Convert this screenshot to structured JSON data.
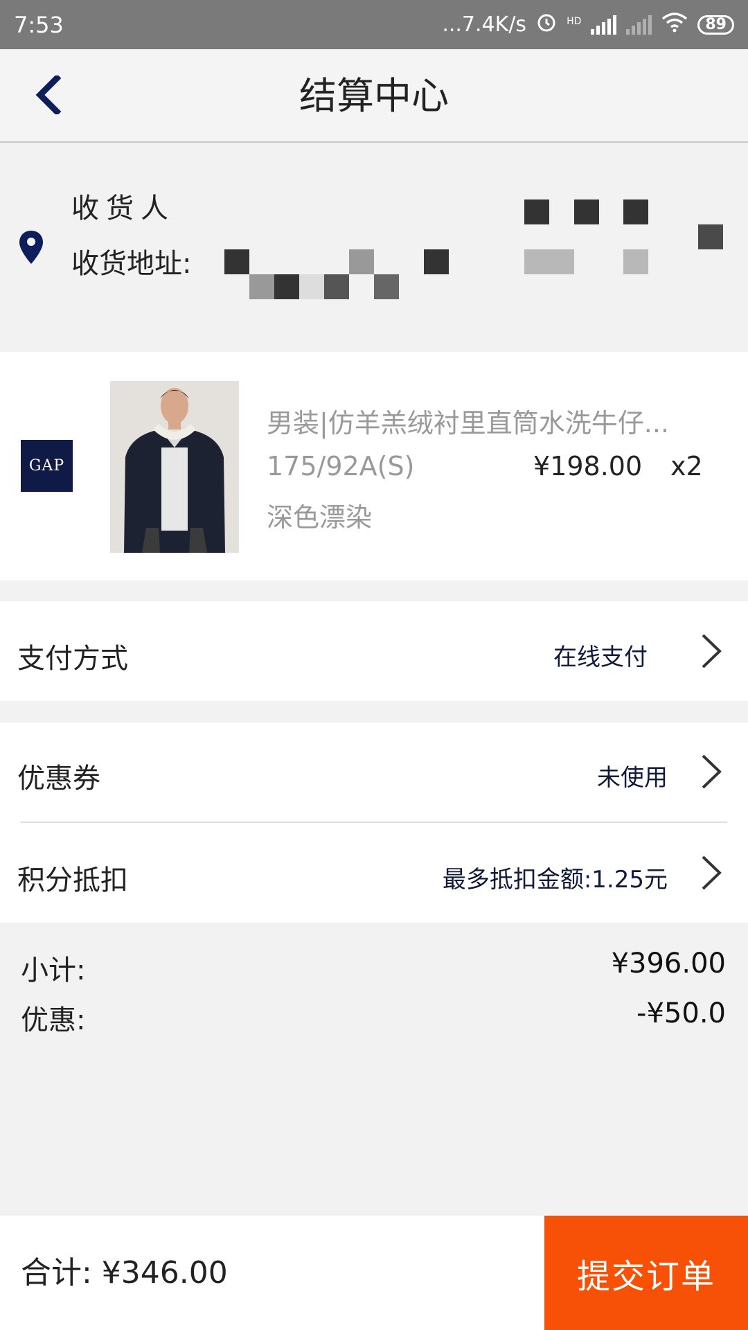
{
  "status_bar": {
    "time": "7:53",
    "network_speed": "...7.4K/s",
    "hd_label": "HD",
    "battery": "89"
  },
  "header": {
    "title": "结算中心",
    "back_icon": "chevron-left-icon"
  },
  "address": {
    "recipient_label": "收货人",
    "address_label": "收货地址:",
    "pin_icon": "location-pin-icon"
  },
  "product": {
    "brand": "GAP",
    "name": "男装|仿羊羔绒衬里直筒水洗牛仔...",
    "size": "175/92A(S)",
    "color": "深色漂染",
    "price": "¥198.00",
    "quantity": "x2"
  },
  "payment": {
    "label": "支付方式",
    "value": "在线支付"
  },
  "coupon": {
    "label": "优惠券",
    "value": "未使用"
  },
  "points": {
    "label": "积分抵扣",
    "value": "最多抵扣金额:1.25元"
  },
  "summary": {
    "subtotal_label": "小计:",
    "subtotal_value": "¥396.00",
    "discount_label": "优惠:",
    "discount_value": "-¥50.0"
  },
  "footer": {
    "total": "合计: ¥346.00",
    "submit_label": "提交订单"
  },
  "colors": {
    "accent": "#f65107",
    "navy": "#0f1a47",
    "status_bar": "#7a7a7a"
  }
}
